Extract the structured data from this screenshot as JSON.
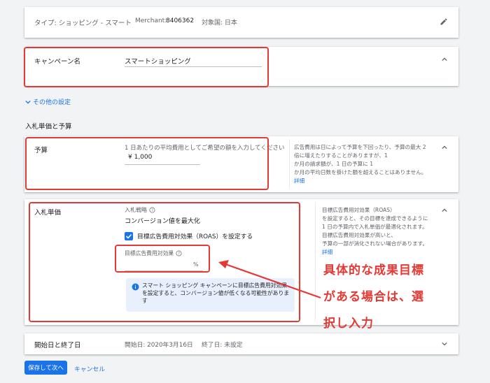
{
  "summary": {
    "type": "タイプ: ショッピング - スマート",
    "merchant_label": "Merchant:",
    "merchant_id": "8406362",
    "country": "対象国: 日本"
  },
  "campaign": {
    "label": "キャンペーン名",
    "value": "スマートショッピング"
  },
  "other_settings": "その他の設定",
  "section_title": "入札単価と予算",
  "budget": {
    "label": "予算",
    "placeholder_text": "1 日あたりの平均費用としてご希望の額を入力してください",
    "value": "¥ 1,000",
    "help_line1": "広告費用は日によって予算を下回ったり、予算の最大 2",
    "help_line2": "倍に増えたりすることがありますが、1",
    "help_line3": "か月の請求額が、1 日の予算に 1",
    "help_line4": "か月の平均日数を掛けた額を超えることはありません。",
    "help_link": "詳細"
  },
  "bidding": {
    "label": "入札単価",
    "strategy_label": "入札戦略",
    "strategy_value": "コンバージョン値を最大化",
    "checkbox_label": "目標広告費用対効果（ROAS）を設定する",
    "target_label": "目標広告費用対効果",
    "target_suffix": "%",
    "info_text": "スマート ショッピング キャンペーンに目標広告費用対効果を設定すると、コンバージョン値が低くなる可能性があります",
    "help_line1": "目標広告費用対効果（ROAS）",
    "help_line2": "を設定すると、その目標を達成できるように",
    "help_line3": "1 日の予算内で入札単価が最適化されます。",
    "help_line4": "目標広告費用対効果が高いと、",
    "help_line5": "予算の一部が消化されない場合があります。",
    "help_link": "詳細"
  },
  "dates": {
    "label": "開始日と終了日",
    "start": "開始日: 2020年3月16日",
    "end": "終了日: 未設定"
  },
  "actions": {
    "save_next": "保存して次へ",
    "cancel": "キャンセル"
  },
  "annotation": {
    "line1": "具体的な成果目標",
    "line2": "がある場合は、選",
    "line3": "択し入力"
  },
  "colors": {
    "accent": "#1a73e8",
    "highlight": "#e53935"
  }
}
